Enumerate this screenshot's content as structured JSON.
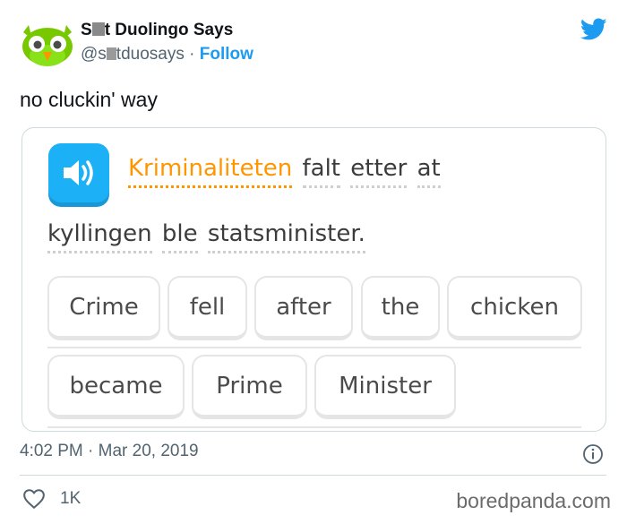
{
  "author": {
    "display_name_start": "S",
    "display_name_end": "t Duolingo Says",
    "handle_start": "@s",
    "handle_end": "tduosays",
    "separator": "·",
    "follow_label": "Follow",
    "avatar_icon": "duolingo-owl-icon",
    "platform_icon": "twitter-bird-icon",
    "brand_color": "#1d9bf0"
  },
  "tweet": {
    "text": "no cluckin' way"
  },
  "exercise": {
    "speaker_icon": "speaker-icon",
    "accent_color": "#1cb0f6",
    "highlight_color": "#ff9600",
    "sentence_line1": [
      "Kriminaliteten",
      "falt",
      "etter",
      "at"
    ],
    "sentence_line2": [
      "kyllingen",
      "ble",
      "statsminister."
    ],
    "tiles_row1": [
      "Crime",
      "fell",
      "after",
      "the",
      "chicken"
    ],
    "tiles_row2": [
      "became",
      "Prime",
      "Minister"
    ]
  },
  "footer": {
    "time": "4:02 PM",
    "separator": "·",
    "date": "Mar 20, 2019",
    "info_icon": "info-icon",
    "like_icon": "heart-icon",
    "like_count": "1K",
    "watermark": "boredpanda.com"
  }
}
